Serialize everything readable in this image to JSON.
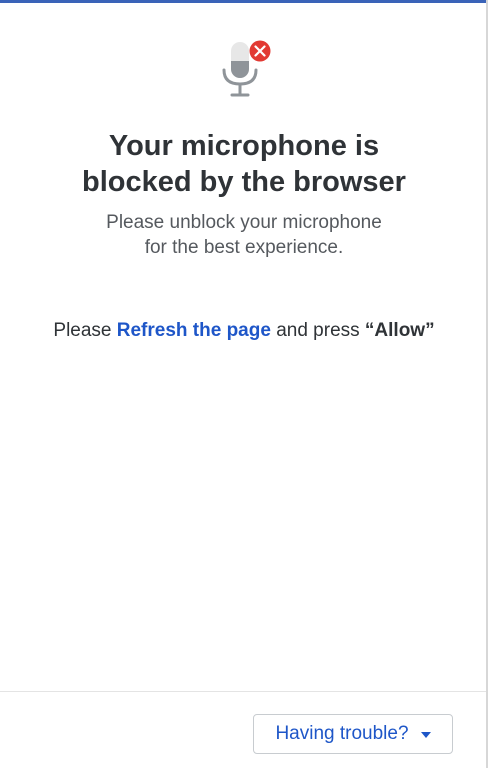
{
  "header": {
    "icon": "microphone-blocked-icon",
    "accent_color": "#3a63b8"
  },
  "main": {
    "title_line1": "Your microphone is",
    "title_line2": "blocked by the browser",
    "subtitle_line1": "Please unblock your microphone",
    "subtitle_line2": "for the best experience.",
    "instruction": {
      "prefix": "Please ",
      "link": "Refresh the page",
      "middle": " and press ",
      "emphasis": "“Allow”"
    },
    "link_color": "#1e56c8",
    "error_color": "#e23a33"
  },
  "footer": {
    "trouble_label": "Having trouble?",
    "trouble_icon": "caret-down-icon"
  }
}
